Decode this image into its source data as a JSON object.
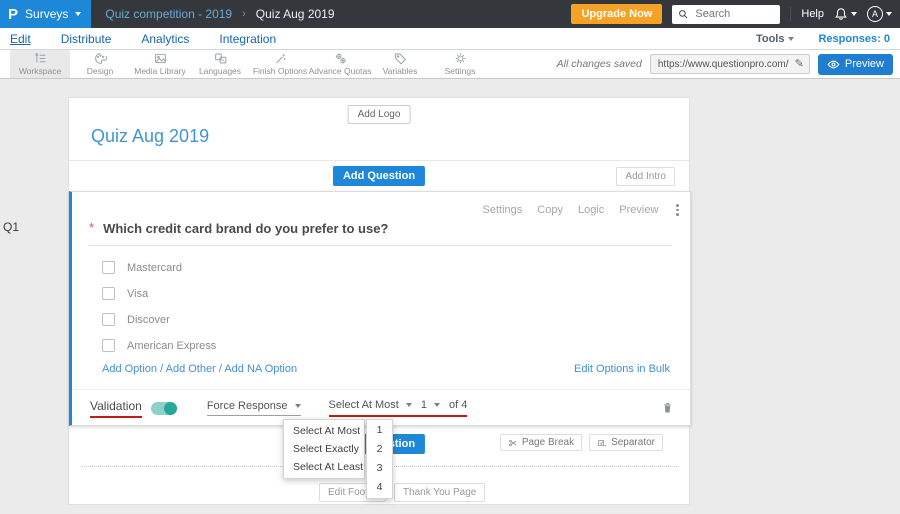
{
  "topbar": {
    "logo_text": "P",
    "product_menu_label": "Surveys",
    "breadcrumb": {
      "parent": "Quiz competition - 2019",
      "separator": "›",
      "current": "Quiz Aug 2019"
    },
    "upgrade_button": "Upgrade Now",
    "search": {
      "placeholder": "Search"
    },
    "help_label": "Help",
    "avatar_initial": "A"
  },
  "subnav": {
    "items": [
      "Edit",
      "Distribute",
      "Analytics",
      "Integration"
    ],
    "active_item": "Edit",
    "tools_label": "Tools",
    "responses_label": "Responses: 0"
  },
  "toolbar": {
    "items": [
      "Workspace",
      "Design",
      "Media Library",
      "Languages",
      "Finish Options",
      "Advance Quotas",
      "Variables",
      "Settings"
    ],
    "active_item": "Workspace",
    "saved_status": "All changes saved",
    "survey_url": "https://www.questionpro.com/t/APNrFZ",
    "preview_label": "Preview"
  },
  "canvas": {
    "add_logo_label": "Add Logo",
    "survey_title": "Quiz Aug 2019",
    "add_question_label": "Add Question",
    "add_intro_label": "Add Intro"
  },
  "question": {
    "code": "Q1",
    "actions": [
      "Settings",
      "Copy",
      "Logic",
      "Preview"
    ],
    "required_marker": "*",
    "text": "Which credit card brand do you prefer to use?",
    "options": [
      "Mastercard",
      "Visa",
      "Discover",
      "American Express"
    ],
    "option_links": [
      "Add Option",
      "Add Other",
      "Add NA Option"
    ],
    "link_separator": "/",
    "bulk_edit_label": "Edit Options in Bulk",
    "validation": {
      "label": "Validation",
      "toggle_state": "on",
      "force_response_label": "Force Response",
      "rule_value": "Select At Most",
      "count_value": "1",
      "of_total_label": "of 4"
    }
  },
  "dropdowns": {
    "rule_options": [
      "Select At Most",
      "Select Exactly",
      "Select At Least"
    ],
    "count_options": [
      "1",
      "2",
      "3",
      "4"
    ]
  },
  "page_footer": {
    "add_question_label": "Add Question",
    "page_break_label": "Page Break",
    "separator_label": "Separator",
    "edit_footer_label": "Edit Footer",
    "thank_you_label": "Thank You Page"
  },
  "colors": {
    "accent_blue": "#1d87d8",
    "orange": "#f7a225",
    "teal_toggle": "#2aa79b",
    "annotation_red": "#c11a1a",
    "topbar_bg": "#34383c"
  }
}
